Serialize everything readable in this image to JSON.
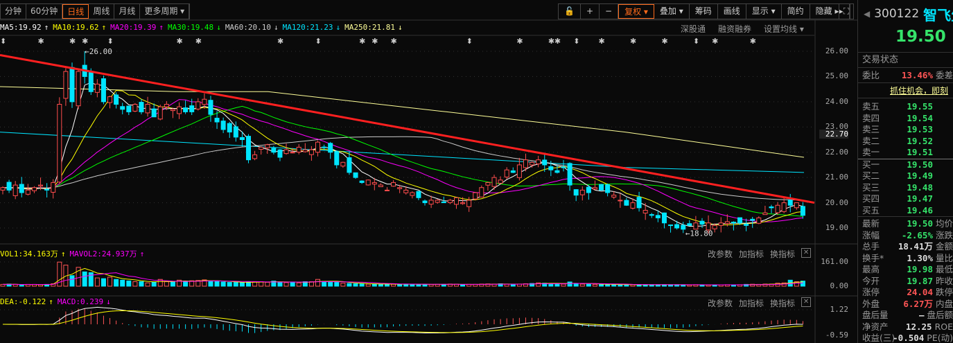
{
  "toolbar": {
    "tabs": [
      "分钟",
      "60分钟",
      "日线",
      "周线",
      "月线",
      "更多周期 ▾"
    ],
    "active_tab": 2,
    "tools": [
      "+",
      "−",
      "复权 ▾",
      "叠加 ▾",
      "筹码",
      "画线",
      "显示 ▾",
      "简约",
      "隐藏 ▸▸"
    ]
  },
  "ma_legend": [
    {
      "label": "MA5:19.92",
      "arrow": "↑",
      "color": "#ffffff"
    },
    {
      "label": "MA10:19.62",
      "arrow": "↑",
      "color": "#ffff00"
    },
    {
      "label": "MA20:19.39",
      "arrow": "↑",
      "color": "#ff00ff"
    },
    {
      "label": "MA30:19.48",
      "arrow": "↓",
      "color": "#00ff00"
    },
    {
      "label": "MA60:20.10",
      "arrow": "↓",
      "color": "#cccccc"
    },
    {
      "label": "MA120:21.23",
      "arrow": "↓",
      "color": "#00e5ff"
    },
    {
      "label": "MA250:21.81",
      "arrow": "↓",
      "color": "#ffff99"
    }
  ],
  "chart_links": [
    "深股通",
    "融资融券",
    "设置均线 ▾"
  ],
  "volume_legend": [
    {
      "label": "VOL1:34.163万",
      "arrow": "↑",
      "color": "#ffff00"
    },
    {
      "label": "MAVOL2:24.937万",
      "arrow": "↑",
      "color": "#ff00ff"
    }
  ],
  "macd_legend": [
    {
      "label": "DEA:-0.122",
      "arrow": "↑",
      "color": "#ffff00"
    },
    {
      "label": "MACD:0.239",
      "arrow": "↓",
      "color": "#ff00ff"
    }
  ],
  "indicator_links": [
    "改参数",
    "加指标",
    "换指标"
  ],
  "close_label": "✕",
  "chart_data": {
    "type": "candlestick",
    "price_axis": {
      "ticks": [
        "26.00",
        "25.00",
        "24.00",
        "23.00",
        "22.00",
        "21.00",
        "20.00",
        "19.00"
      ],
      "current": "22.70",
      "ylim": [
        18.6,
        26.3
      ]
    },
    "annotations": {
      "high": "26.00",
      "low": "18.80"
    },
    "closes": [
      20.6,
      20.5,
      20.7,
      20.4,
      20.5,
      20.6,
      20.7,
      20.5,
      20.8,
      23.9,
      25.2,
      24.0,
      25.2,
      25.0,
      24.4,
      24.7,
      24.0,
      24.2,
      23.9,
      23.7,
      23.6,
      23.9,
      23.6,
      23.9,
      23.4,
      23.8,
      23.9,
      23.7,
      23.8,
      23.6,
      23.6,
      24.0,
      24.1,
      23.5,
      23.2,
      22.9,
      22.8,
      22.6,
      22.5,
      21.7,
      21.9,
      22.2,
      22.3,
      22.0,
      21.8,
      22.1,
      22.0,
      22.2,
      22.1,
      22.1,
      22.4,
      22.2,
      22.0,
      21.5,
      21.6,
      21.2,
      21.0,
      20.8,
      20.9,
      20.8,
      20.7,
      20.5,
      20.8,
      20.6,
      20.5,
      20.4,
      20.2,
      20.0,
      20.1,
      20.1,
      20.0,
      20.1,
      20.2,
      20.0,
      20.1,
      20.4,
      20.6,
      20.8,
      21.0,
      20.9,
      21.3,
      21.2,
      21.5,
      21.7,
      21.6,
      21.7,
      21.5,
      21.3,
      21.2,
      21.4,
      20.7,
      20.3,
      20.5,
      20.4,
      20.6,
      20.5,
      20.4,
      20.3,
      20.1,
      19.9,
      20.0,
      19.8,
      19.7,
      19.5,
      19.4,
      19.2,
      19.1,
      19.0,
      18.95,
      19.1,
      19.2,
      19.15,
      19.2,
      19.1,
      19.2,
      19.25,
      19.2,
      19.2,
      19.1,
      19.3,
      19.4,
      19.6,
      19.8,
      19.9,
      20.0,
      19.9,
      20.0,
      19.5
    ],
    "ma120": [
      22.8,
      22.6,
      22.4,
      22.2,
      22.0,
      21.8,
      21.6,
      21.4,
      21.3,
      21.2
    ],
    "ma250": [
      24.6,
      24.5,
      24.4,
      24.4,
      24.0,
      23.6,
      23.2,
      22.8,
      22.3,
      21.8
    ],
    "trendline": [
      25.85,
      20.0
    ],
    "volume_axis": [
      "161.00",
      "0.00"
    ],
    "volume": [
      12,
      14,
      12,
      6,
      12,
      12,
      10,
      12,
      16,
      160,
      140,
      70,
      125,
      95,
      90,
      55,
      50,
      60,
      45,
      40,
      35,
      30,
      30,
      22,
      28,
      45,
      30,
      28,
      40,
      30,
      36,
      38,
      42,
      35,
      30,
      28,
      25,
      25,
      24,
      28,
      30,
      30,
      26,
      34,
      26,
      24,
      28,
      22,
      30,
      30,
      45,
      32,
      28,
      28,
      20,
      18,
      16,
      15,
      14,
      14,
      13,
      15,
      13,
      12,
      14,
      12,
      12,
      12,
      11,
      12,
      12,
      14,
      13,
      10,
      12,
      12,
      14,
      15,
      14,
      16,
      13,
      12,
      14,
      16,
      18,
      22,
      20,
      18,
      16,
      14,
      28,
      18,
      14,
      13,
      12,
      12,
      12,
      10,
      10,
      10,
      10,
      10,
      10,
      10,
      10,
      10,
      10,
      10,
      8,
      8,
      10,
      9,
      8,
      9,
      9,
      10,
      9,
      10,
      12,
      13,
      12,
      14,
      14,
      20,
      22,
      40,
      30,
      34
    ],
    "macd_axis": [
      "1.22",
      "-0.59"
    ]
  },
  "panel": {
    "code": "300122",
    "name": "智飞生物",
    "price": "19.50",
    "trade_status": "交易状态",
    "weibi": {
      "label": "委比",
      "value": "13.46%",
      "right": "委差"
    },
    "promo": "抓住机会，即刻",
    "asks": [
      {
        "label": "卖五",
        "price": "19.55"
      },
      {
        "label": "卖四",
        "price": "19.54"
      },
      {
        "label": "卖三",
        "price": "19.53"
      },
      {
        "label": "卖二",
        "price": "19.52"
      },
      {
        "label": "卖一",
        "price": "19.51"
      }
    ],
    "bids": [
      {
        "label": "买一",
        "price": "19.50"
      },
      {
        "label": "买二",
        "price": "19.49"
      },
      {
        "label": "买三",
        "price": "19.48"
      },
      {
        "label": "买四",
        "price": "19.47"
      },
      {
        "label": "买五",
        "price": "19.46"
      }
    ],
    "stats": [
      {
        "label": "最新",
        "value": "19.50",
        "right": "均价",
        "c": "g"
      },
      {
        "label": "涨幅",
        "value": "-2.65%",
        "right": "涨跌",
        "c": "g"
      },
      {
        "label": "总手",
        "value": "18.41万",
        "right": "金额",
        "c": "w"
      },
      {
        "label": "换手*",
        "value": "1.30%",
        "right": "量比",
        "c": "w"
      },
      {
        "label": "最高",
        "value": "19.98",
        "right": "最低",
        "c": "g"
      },
      {
        "label": "今开",
        "value": "19.87",
        "right": "昨收",
        "c": "g"
      },
      {
        "label": "涨停",
        "value": "24.04",
        "right": "跌停",
        "c": "red"
      },
      {
        "label": "外盘",
        "value": "6.27万",
        "right": "内盘",
        "c": "red"
      },
      {
        "label": "盘后量",
        "value": "—",
        "right": "盘后额",
        "c": "w"
      },
      {
        "label": "净资产",
        "value": "12.25",
        "right": "ROE",
        "c": "w"
      },
      {
        "label": "收益(三)",
        "value": "-0.504",
        "right": "PE(动)",
        "c": "w"
      }
    ]
  }
}
